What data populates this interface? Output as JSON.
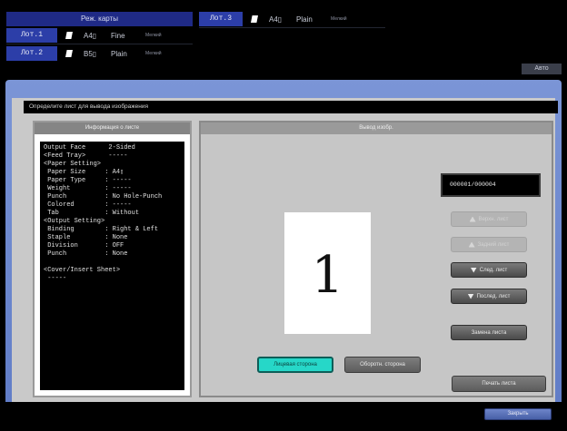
{
  "header": {
    "tray_settings_title": "Реж. карты",
    "auto_label": "Авто",
    "trays": [
      {
        "label": "Лот.1",
        "size": "A4▯",
        "type": "Fine",
        "sub": "Мелкий"
      },
      {
        "label": "Лот.2",
        "size": "B5▯",
        "type": "Plain",
        "sub": "Мелкий"
      },
      {
        "label": "Лот.3",
        "size": "A4▯",
        "type": "Plain",
        "sub": "Мелкий"
      }
    ]
  },
  "instruction": "Определите лист для вывода изображения",
  "left_panel": {
    "header": "Информация о листе",
    "lines": [
      "Output Face      2-Sided",
      "<Feed Tray>      -----",
      "<Paper Setting>",
      " Paper Size     : A4▯",
      " Paper Type     : -----",
      " Weight         : -----",
      " Punch          : No Hole-Punch",
      " Colored        : -----",
      " Tab            : Without",
      "<Output Setting>",
      " Binding        : Right & Left",
      " Staple         : None",
      " Division       : OFF",
      " Punch          : None",
      "",
      "<Cover/Insert Sheet>",
      " -----"
    ]
  },
  "right_panel": {
    "header": "Вывод изобр.",
    "page_number": "1",
    "counter": "000001/000004",
    "buttons": {
      "first_sheet": "Верхн. лист",
      "prev_sheet": "Задний лист",
      "next_sheet": "След. лист",
      "last_sheet": "Послед. лист",
      "change_sheet": "Замена листа",
      "print_sheet": "Печать листа",
      "front_side": "Лицевая сторона",
      "back_side": "Оборотн. сторона"
    }
  },
  "footer": {
    "close": "Закрыть"
  },
  "colors": {
    "accent_blue": "#5f7bc6",
    "selected_cyan": "#26d7c8",
    "tray_blue": "#2c3ea8"
  }
}
